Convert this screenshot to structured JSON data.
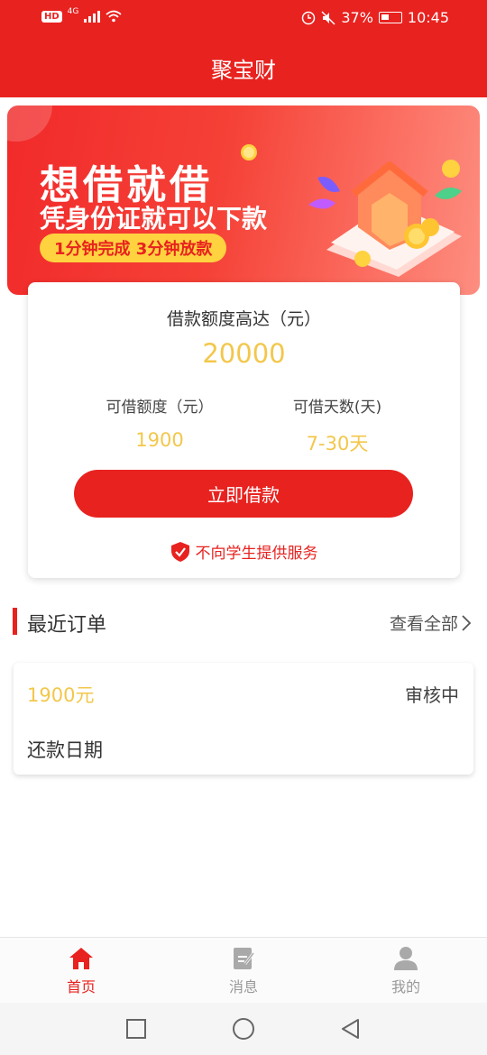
{
  "status_bar": {
    "left_badge": "HD",
    "network": "4G",
    "battery": "37%",
    "time": "10:45"
  },
  "app": {
    "title": "聚宝财"
  },
  "banner": {
    "headline": "想借就借",
    "subline": "凭身份证就可以下款",
    "pill": "1分钟完成 3分钟放款"
  },
  "loan_card": {
    "max_label": "借款额度高达（元）",
    "max_amount": "20000",
    "available_label": "可借额度（元）",
    "available_value": "1900",
    "days_label": "可借天数(天)",
    "days_value": "7-30天",
    "button_label": "立即借款",
    "notice": "不向学生提供服务"
  },
  "orders": {
    "section_title": "最近订单",
    "view_all": "查看全部",
    "items": [
      {
        "amount": "1900元",
        "status": "审核中",
        "repay_label": "还款日期"
      }
    ]
  },
  "bottom_nav": {
    "items": [
      {
        "label": "首页",
        "icon": "home-icon",
        "active": true
      },
      {
        "label": "消息",
        "icon": "message-icon",
        "active": false
      },
      {
        "label": "我的",
        "icon": "profile-icon",
        "active": false
      }
    ]
  },
  "colors": {
    "brand_red": "#e8221f",
    "accent_yellow": "#f3c74b",
    "pill_yellow": "#ffd23f",
    "inactive_gray": "#999999"
  }
}
